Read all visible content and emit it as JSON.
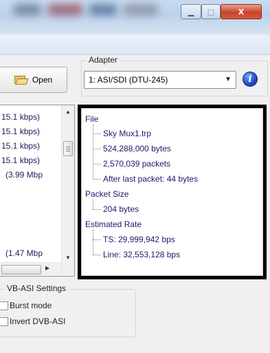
{
  "titlebar": {
    "minimize_glyph": "▁",
    "maximize_glyph": "□",
    "close_glyph": "X"
  },
  "toolbar": {
    "open_label": "Open",
    "open_icon": "folder-open-icon"
  },
  "adapter": {
    "group_label": "Adapter",
    "selected_value": "1: ASI/SDI (DTU-245)",
    "info_glyph": "i"
  },
  "rates_list": {
    "rows": [
      "15.1 kbps)",
      "15.1 kbps)",
      "15.1 kbps)",
      "15.1 kbps)",
      "(3.99 Mbp",
      "(1.47 Mbp"
    ]
  },
  "details": {
    "file_label": "File",
    "file_name": "Sky Mux1.trp",
    "file_bytes": "524,288,000 bytes",
    "file_packets": "2,570,039 packets",
    "after_last_packet": "After last packet: 44 bytes",
    "packet_size_label": "Packet Size",
    "packet_size_value": "204 bytes",
    "estimated_rate_label": "Estimated Rate",
    "ts_rate": "TS: 29,999,942 bps",
    "line_rate": "Line: 32,553,128 bps"
  },
  "settings": {
    "group_label": "VB-ASI Settings",
    "burst_mode_label": "Burst mode",
    "burst_mode_checked": false,
    "invert_label": "Invert DVB-ASI",
    "invert_checked": false
  },
  "colors": {
    "tree_text": "#1a1a6e",
    "frame": "#000000",
    "close_button": "#c8452c"
  }
}
